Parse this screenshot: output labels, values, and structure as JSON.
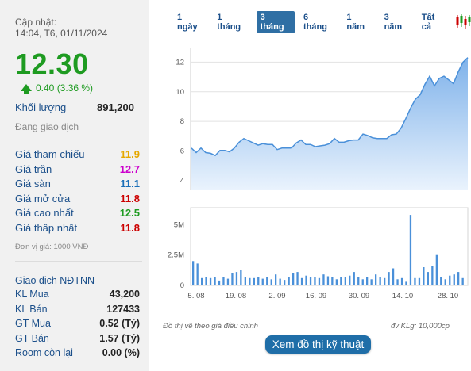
{
  "stock": {
    "updated_label": "Cập nhật:",
    "updated_time": "14:04, T6, 01/11/2024",
    "price": "12.30",
    "change": "0.40 (3.36 %)",
    "volume_label": "Khối lượng",
    "volume": "891,200",
    "status": "Đang giao dịch",
    "unit_note": "Đơn vị giá: 1000 VNĐ"
  },
  "price_list": [
    {
      "label": "Giá tham chiếu",
      "value": "11.9",
      "color": "#e6a800"
    },
    {
      "label": "Giá trần",
      "value": "12.7",
      "color": "#cc00cc"
    },
    {
      "label": "Giá sàn",
      "value": "11.1",
      "color": "#1b6fb8"
    },
    {
      "label": "Giá mở cửa",
      "value": "11.8",
      "color": "#cc0000"
    },
    {
      "label": "Giá cao nhất",
      "value": "12.5",
      "color": "#1e9b21"
    },
    {
      "label": "Giá thấp nhất",
      "value": "11.8",
      "color": "#cc0000"
    }
  ],
  "foreign": {
    "title": "Giao dịch NĐTNN",
    "rows": [
      {
        "label": "KL Mua",
        "value": "43,200"
      },
      {
        "label": "KL Bán",
        "value": "127433"
      },
      {
        "label": "GT Mua",
        "value": "0.52 (Tỷ)"
      },
      {
        "label": "GT Bán",
        "value": "1.57 (Tỷ)"
      },
      {
        "label": "Room còn lại",
        "value": "0.00 (%)"
      }
    ]
  },
  "tabs": [
    "1 ngày",
    "1 tháng",
    "3 tháng",
    "6 tháng",
    "1 năm",
    "3 năm",
    "Tất cả"
  ],
  "active_tab": "3 tháng",
  "chart_icon": "candlestick-icon",
  "footer": {
    "note": "Đồ thị vẽ theo giá điều chỉnh",
    "volume_unit": "đv KLg: 10,000cp",
    "button": "Xem đồ thị kỹ thuật"
  },
  "chart_data": [
    {
      "type": "area",
      "title": "",
      "xlabel": "",
      "ylabel": "",
      "ylim": [
        4,
        12.5
      ],
      "yticks": [
        4,
        6,
        8,
        10,
        12
      ],
      "x_tick_labels": [
        "5. 08",
        "19. 08",
        "2. 09",
        "16. 09",
        "30. 09",
        "14. 10",
        "28. 10"
      ],
      "grid": true,
      "colors": {
        "line": "#4a90d9",
        "fill": "#a9ccf1"
      },
      "values": [
        6.2,
        5.9,
        6.2,
        5.9,
        5.85,
        5.7,
        6.05,
        6.05,
        5.95,
        6.2,
        6.6,
        6.85,
        6.7,
        6.55,
        6.4,
        6.5,
        6.45,
        6.45,
        6.1,
        6.2,
        6.2,
        6.2,
        6.55,
        6.75,
        6.45,
        6.45,
        6.3,
        6.35,
        6.4,
        6.5,
        6.85,
        6.6,
        6.6,
        6.7,
        6.75,
        6.75,
        7.15,
        7.05,
        6.9,
        6.85,
        6.85,
        6.85,
        7.1,
        7.15,
        7.55,
        8.2,
        8.9,
        9.5,
        9.8,
        10.5,
        11.05,
        10.4,
        10.9,
        11.05,
        10.8,
        10.55,
        11.35,
        12.0,
        12.3
      ]
    },
    {
      "type": "bar",
      "title": "",
      "xlabel": "",
      "ylabel": "",
      "ylim": [
        0,
        6
      ],
      "ytick_labels": [
        "0",
        "2.5M",
        "5M"
      ],
      "colors": {
        "bar": "#4a90d9"
      },
      "values": [
        2.0,
        1.8,
        0.6,
        0.7,
        0.6,
        0.7,
        0.4,
        0.7,
        0.55,
        1.0,
        1.1,
        1.3,
        0.7,
        0.6,
        0.6,
        0.7,
        0.55,
        0.7,
        0.5,
        0.9,
        0.55,
        0.45,
        0.7,
        1.0,
        1.1,
        0.6,
        0.8,
        0.7,
        0.7,
        0.6,
        0.9,
        0.75,
        0.65,
        0.5,
        0.7,
        0.7,
        0.8,
        1.1,
        0.7,
        0.5,
        0.7,
        0.5,
        0.9,
        0.7,
        0.6,
        1.1,
        1.4,
        0.5,
        0.6,
        0.3,
        5.8,
        0.6,
        0.6,
        1.5,
        1.1,
        1.6,
        2.5,
        0.7,
        0.5,
        0.8,
        0.9,
        1.1,
        0.6
      ]
    }
  ]
}
